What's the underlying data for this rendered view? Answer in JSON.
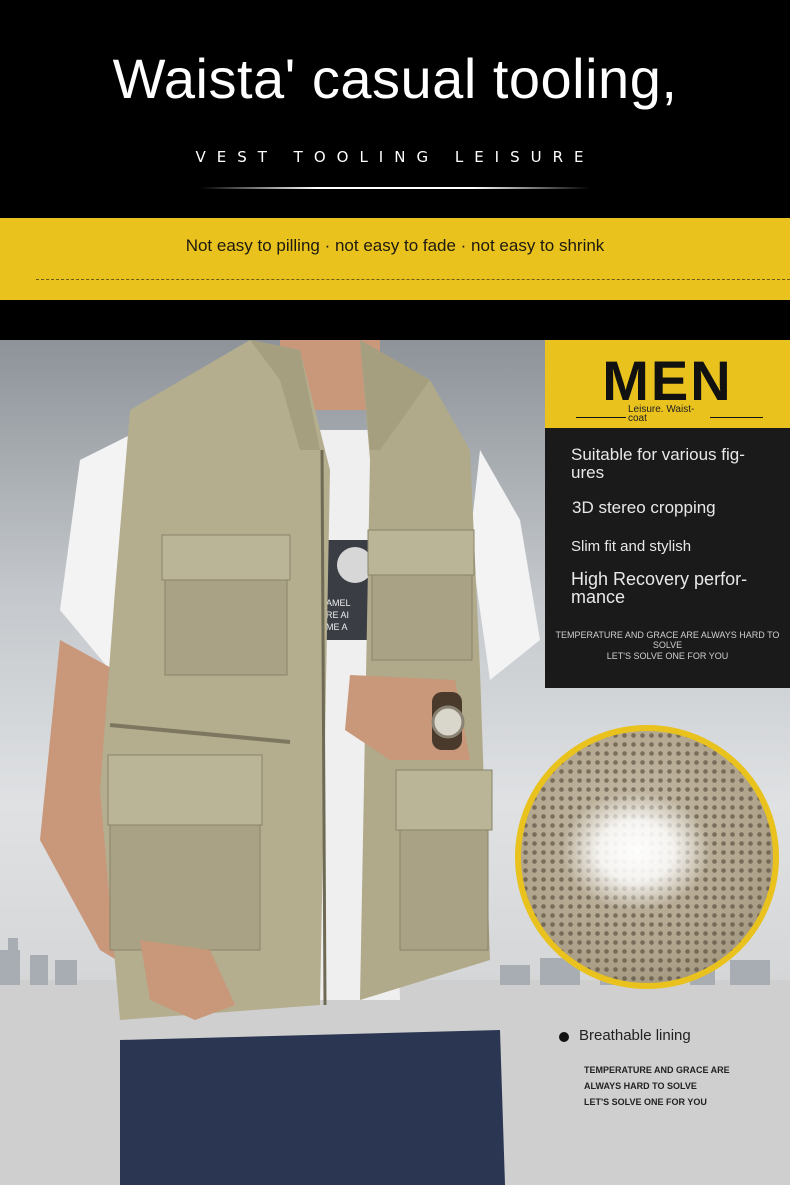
{
  "header": {
    "headline": "Waista' casual tooling,",
    "subhead": "VEST TOOLING LEISURE"
  },
  "band": {
    "text": "Not easy to pilling · not easy to fade · not easy to shrink"
  },
  "men_panel": {
    "title": "MEN",
    "subtitle": "Leisure. Waist-coat",
    "features": [
      "Suitable for various fig-ures",
      "3D stereo cropping",
      "Slim fit and stylish",
      "High Recovery perfor-mance"
    ],
    "note_line_1": "TEMPERATURE AND GRACE ARE ALWAYS HARD TO SOLVE",
    "note_line_2": "LET'S SOLVE ONE FOR YOU"
  },
  "lining": {
    "label": "Breathable lining",
    "note_lines": [
      "TEMPERATURE AND GRACE ARE",
      "ALWAYS HARD TO SOLVE",
      "LET'S SOLVE ONE FOR YOU"
    ]
  },
  "tshirt_print": [
    "AMEL",
    "RE AI",
    "ME A"
  ],
  "colors": {
    "accent_yellow": "#e9c21e",
    "background_black": "#000000",
    "vest_khaki": "#b4ad8e"
  }
}
